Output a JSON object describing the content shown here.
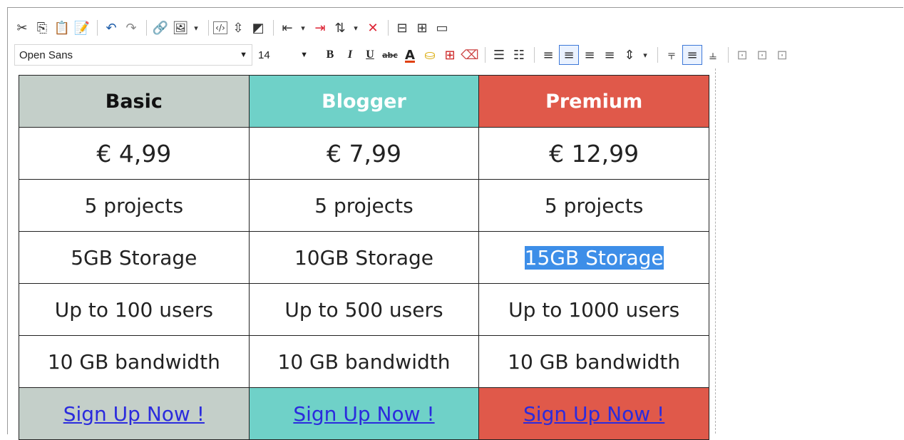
{
  "toolbar1": {
    "icons": [
      "cut-icon",
      "copy-icon",
      "paste-icon",
      "paste-special-icon",
      "undo-icon",
      "redo-icon",
      "link-icon",
      "image-icon",
      "code-icon",
      "page-break-icon",
      "contrast-icon",
      "indent-icon",
      "remove-format-icon",
      "move-icon",
      "delete-icon",
      "table-icon",
      "table-grid-icon",
      "window-icon"
    ]
  },
  "toolbar2": {
    "font_family": "Open Sans",
    "font_size": "14",
    "bold": "B",
    "italic": "I",
    "underline": "U",
    "strike": "abc",
    "font_color": "A",
    "accent_text": "#e04010",
    "accent_bg": "#f0c000"
  },
  "table": {
    "headers": [
      {
        "label": "Basic",
        "color": "#c4cfc9"
      },
      {
        "label": "Blogger",
        "color": "#6fd1c8"
      },
      {
        "label": "Premium",
        "color": "#e0594a"
      }
    ],
    "prices": [
      "€ 4,99",
      "€ 7,99",
      "€ 12,99"
    ],
    "rows": [
      [
        "5 projects",
        "5 projects",
        "5 projects"
      ],
      [
        "5GB Storage",
        "10GB Storage",
        "15GB Storage"
      ],
      [
        "Up to 100 users",
        "Up to 500 users",
        "Up to 1000 users"
      ],
      [
        "10 GB bandwidth",
        "10 GB bandwidth",
        "10 GB bandwidth"
      ]
    ],
    "cta": [
      "Sign Up Now !",
      "Sign Up Now !",
      "Sign Up Now !"
    ]
  }
}
